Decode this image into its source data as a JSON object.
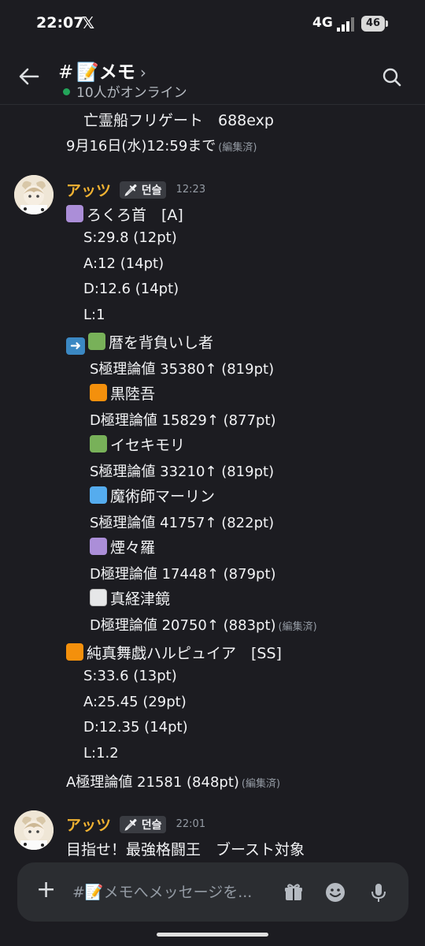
{
  "status_bar": {
    "time": "22:07",
    "x_logo": "𝕏",
    "network": "4G",
    "battery": "46"
  },
  "header": {
    "hash": "#",
    "channel_emoji": "📝",
    "channel_name": "メモ",
    "chevron": "›",
    "online_text": "10人がオンライン"
  },
  "messages": {
    "prev_line1": "亡霊船フリゲート　688exp",
    "prev_line2": "9月16日(水)12:59まで",
    "edited_label": "(編集済)",
    "author": "アッツ",
    "tag": "🗡 던슬",
    "msg1_time": "12:23",
    "msg1": {
      "l1": "ろくろ首　[A]",
      "l2": "S:29.8 (12pt)",
      "l3": "A:12 (14pt)",
      "l4": "D:12.6 (14pt)",
      "l5": "L:1",
      "l6": "暦を背負いし者",
      "l7": "S極理論値 35380↑ (819pt)",
      "l8": "黒陸吾",
      "l9": "D極理論値 15829↑ (877pt)",
      "l10": "イセキモリ",
      "l11": "S極理論値 33210↑ (819pt)",
      "l12": "魔術師マーリン",
      "l13": "S極理論値 41757↑ (822pt)",
      "l14": "煙々羅",
      "l15": "D極理論値 17448↑ (879pt)",
      "l16": "真経津鏡",
      "l17": "D極理論値 20750↑ (883pt)",
      "l18": "純真舞戯ハルピュイア　[SS]",
      "l19": "S:33.6 (13pt)",
      "l20": "A:25.45 (29pt)",
      "l21": "D:12.35 (14pt)",
      "l22": "L:1.2",
      "l23": "A極理論値 21581 (848pt)"
    },
    "msg2_time": "22:01",
    "msg2_text": "目指せ！最強格闘王　ブースト対象"
  },
  "composer": {
    "placeholder": "#📝メモへメッセージを..."
  },
  "colors": {
    "background": "#1c1c21",
    "author": "#f0b232",
    "online": "#23a55a"
  },
  "icons": [
    "back-arrow-icon",
    "search-icon",
    "plus-icon",
    "gift-icon",
    "emoji-icon",
    "mic-icon"
  ]
}
